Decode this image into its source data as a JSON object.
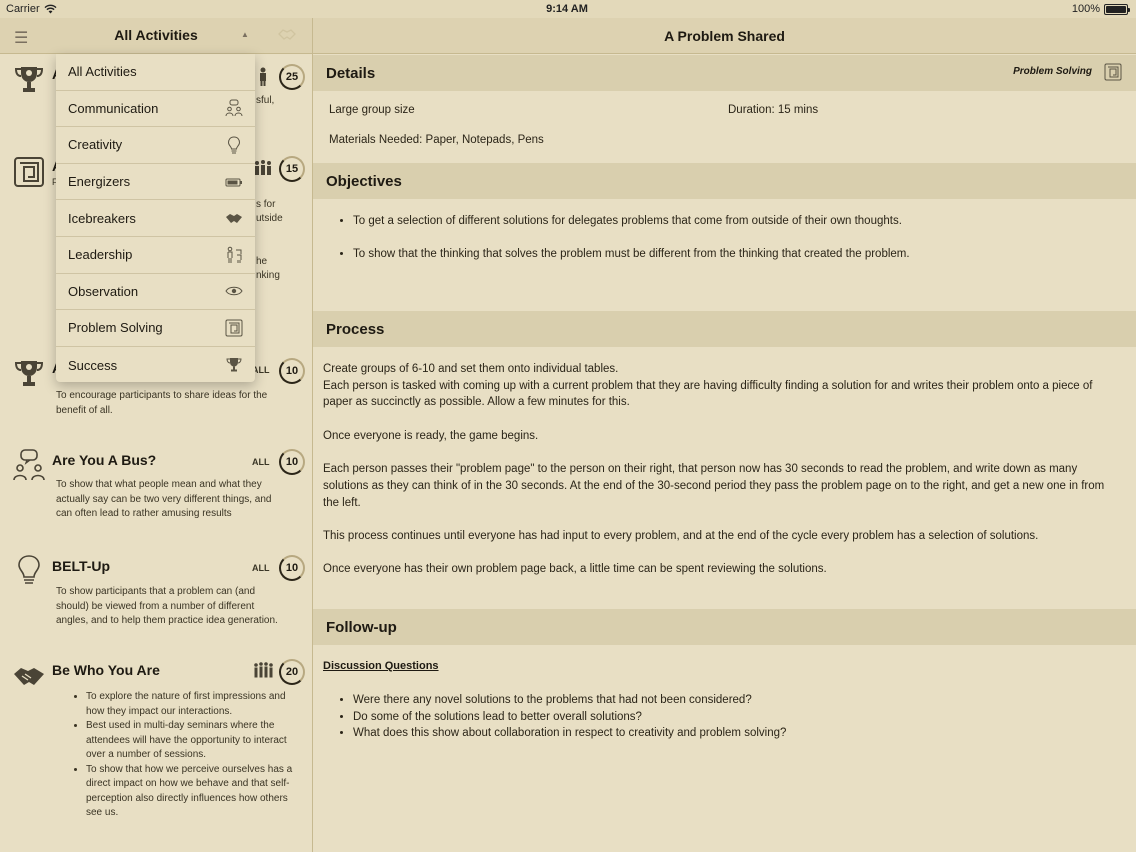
{
  "status": {
    "carrier": "Carrier",
    "time": "9:14 AM",
    "battery": "100%"
  },
  "nav": {
    "left_title": "All Activities",
    "right_title": "A Problem Shared"
  },
  "dropdown": [
    {
      "label": "All Activities",
      "icon": ""
    },
    {
      "label": "Communication",
      "icon": "communication-icon"
    },
    {
      "label": "Creativity",
      "icon": "lightbulb-icon"
    },
    {
      "label": "Energizers",
      "icon": "battery-icon"
    },
    {
      "label": "Icebreakers",
      "icon": "handshake-icon"
    },
    {
      "label": "Leadership",
      "icon": "leadership-icon"
    },
    {
      "label": "Observation",
      "icon": "eye-icon"
    },
    {
      "label": "Problem Solving",
      "icon": "maze-icon"
    },
    {
      "label": "Success",
      "icon": "trophy-icon"
    }
  ],
  "list": {
    "item1": {
      "title": "A",
      "count": "25",
      "partial": [
        "sful,"
      ]
    },
    "item2": {
      "title": "A",
      "count": "15",
      "partial": [
        "s for",
        "utside",
        "he",
        "nking"
      ],
      "sub": "F"
    },
    "item3": {
      "title": "A",
      "all": "ALL",
      "count": "10",
      "desc": "To encourage participants to share ideas for the benefit of all."
    },
    "item4": {
      "title": "Are You A Bus?",
      "all": "ALL",
      "count": "10",
      "desc": "To show that what people mean and what they actually say can be two very different things, and can often lead to rather amusing results"
    },
    "item5": {
      "title": "BELT-Up",
      "all": "ALL",
      "count": "10",
      "desc": "To show participants that a problem can (and should) be viewed from a number of different angles, and to help them practice idea generation."
    },
    "item6": {
      "title": "Be Who You Are",
      "count": "20",
      "bullets": [
        "To explore the nature of first impressions and how they impact our interactions.",
        "Best used in multi-day seminars where the attendees will have the opportunity to interact over a number of sessions.",
        "To show that how we perceive ourselves has a direct impact on how we behave and that self-perception also directly influences how others see us."
      ]
    }
  },
  "detail": {
    "details_head": "Details",
    "category": "Problem Solving",
    "group_size": "Large group size",
    "duration": "Duration: 15 mins",
    "materials": "Materials Needed: Paper, Notepads, Pens",
    "objectives_head": "Objectives",
    "objectives": [
      "To get a selection of different solutions for delegates problems that come from outside of their own thoughts.",
      "To show that the thinking that solves the problem must be different from the thinking that created the problem."
    ],
    "process_head": "Process",
    "process_p1": "Create groups of 6-10 and set them onto individual tables.",
    "process_p2": "Each person is tasked with coming up with a current problem that they are having difficulty finding a solution for and writes their problem onto a piece of paper as succinctly as possible. Allow a few minutes for this.",
    "process_p3": "Once everyone is ready, the game begins.",
    "process_p4": "Each person passes their \"problem page\" to the person on their right, that person now has 30 seconds to read the problem, and write down as many solutions as they can think of in the 30 seconds. At the end of the 30-second period they pass the problem page on to the right, and get a new one in from the left.",
    "process_p5": "This process continues until everyone has had input to every problem, and at the end of the cycle every problem has a selection of solutions.",
    "process_p6": "Once everyone has their own problem page back, a little time can be spent reviewing the solutions.",
    "followup_head": "Follow-up",
    "discussion_label": "Discussion Questions",
    "questions": [
      "Were there any novel solutions to the problems that had not been considered?",
      "Do some of the solutions lead to better overall solutions?",
      "What does this show about collaboration in respect to creativity and problem solving?"
    ]
  }
}
